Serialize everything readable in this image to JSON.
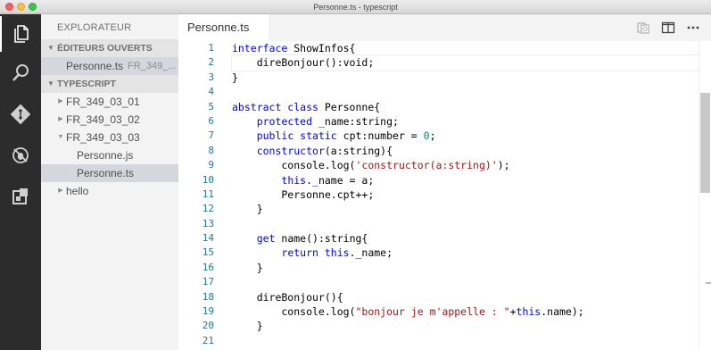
{
  "window": {
    "title": "Personne.ts - typescript"
  },
  "activity_bar": {
    "icons": [
      "files-icon",
      "search-icon",
      "git-icon",
      "debug-icon",
      "extensions-icon"
    ]
  },
  "sidebar": {
    "title": "EXPLORATEUR",
    "open_editors": {
      "label": "ÉDITEURS OUVERTS",
      "items": [
        {
          "name": "Personne.ts",
          "path": "FR_349_..."
        }
      ]
    },
    "workspace": {
      "label": "TYPESCRIPT",
      "items": [
        {
          "label": "FR_349_03_01",
          "twisty": "▶"
        },
        {
          "label": "FR_349_03_02",
          "twisty": "▶"
        },
        {
          "label": "FR_349_03_03",
          "twisty": "▼"
        },
        {
          "label": "Personne.js"
        },
        {
          "label": "Personne.ts"
        },
        {
          "label": "hello",
          "twisty": "▶"
        }
      ]
    }
  },
  "editor": {
    "tab_label": "Personne.ts",
    "line_numbers": [
      "1",
      "2",
      "3",
      "4",
      "5",
      "6",
      "7",
      "8",
      "9",
      "10",
      "11",
      "12",
      "13",
      "14",
      "15",
      "16",
      "17",
      "18",
      "19",
      "20",
      "21"
    ],
    "tokens": {
      "l1_kw": "interface",
      "l1_rest": " ShowInfos{",
      "l2": "    direBonjour():void;",
      "l3": "}",
      "l5_kw": "abstract class",
      "l5_rest": " Personne{",
      "l6_kw": "protected",
      "l6_rest": " _name:string;",
      "l7_kw": "public static",
      "l7_rest": " cpt:number = ",
      "l7_num": "0",
      "l7_end": ";",
      "l8_kw": "constructor",
      "l8_rest": "(a:string){",
      "l9_pre": "        console.log(",
      "l9_str": "'constructor(a:string)'",
      "l9_end": ");",
      "l10_kw": "this",
      "l10_rest": "._name = a;",
      "l11": "        Personne.cpt++;",
      "l12": "    }",
      "l14_kw": "get",
      "l14_rest": " name():string{",
      "l15_kw": "return this",
      "l15_rest": "._name;",
      "l16": "    }",
      "l18": "    direBonjour(){",
      "l19_pre": "        console.log(",
      "l19_str": "\"bonjour je m'appelle : \"",
      "l19_mid": "+",
      "l19_kw": "this",
      "l19_end": ".name);",
      "l20": "    }"
    }
  },
  "colors": {
    "keyword": "#0000ff",
    "string": "#a31515",
    "number": "#09885a",
    "line_number": "#237893",
    "activity_bar": "#2c2c2c",
    "sidebar": "#f3f3f3"
  }
}
